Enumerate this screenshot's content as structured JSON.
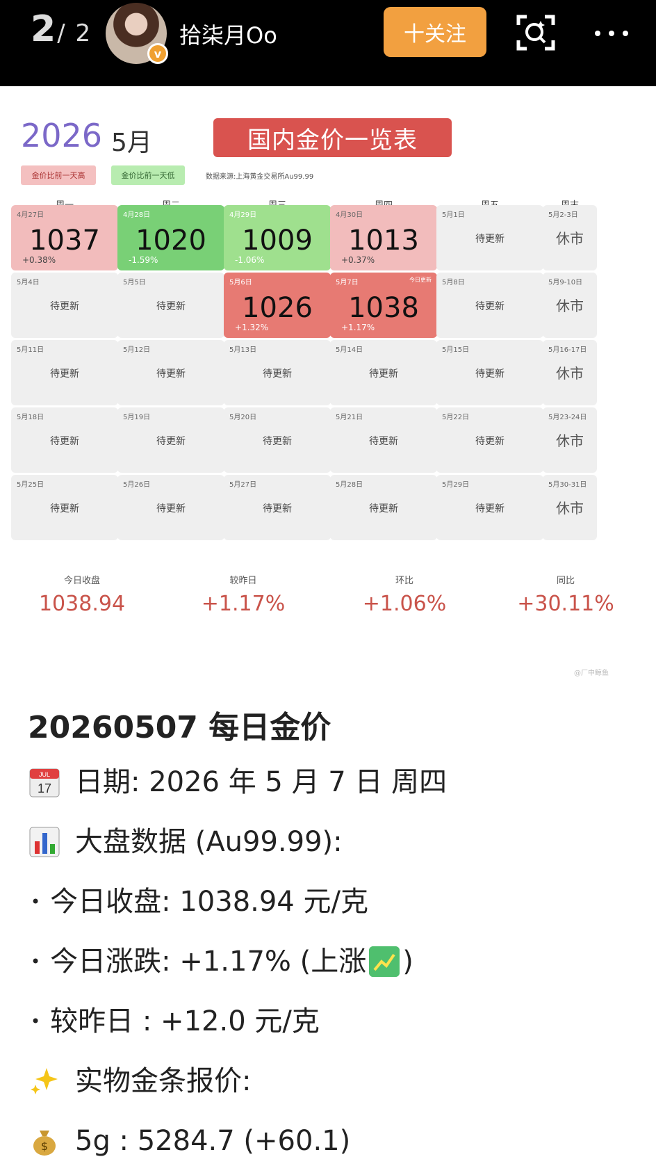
{
  "topbar": {
    "page_current": "2",
    "page_total": "/ 2",
    "username": "拾柒月Oo",
    "verified_badge": "v",
    "follow_label": "十关注",
    "icons": [
      "scan-icon",
      "more-icon"
    ]
  },
  "calendar": {
    "year": "2026",
    "month": "5月",
    "title": "国内金价一览表",
    "legend_high": "金价比前一天高",
    "legend_low": "金价比前一天低",
    "source": "数据来源:上海黄金交易所Au99.99",
    "weekdays": [
      "周一",
      "周二",
      "周三",
      "周四",
      "周五",
      "周末"
    ],
    "pending_label": "待更新",
    "closed_label": "休市",
    "today_tag": "今日更新",
    "rows": [
      [
        {
          "date": "4月27日",
          "price": "1037",
          "change": "+0.38%",
          "state": "up"
        },
        {
          "date": "4月28日",
          "price": "1020",
          "change": "-1.59%",
          "state": "down"
        },
        {
          "date": "4月29日",
          "price": "1009",
          "change": "-1.06%",
          "state": "down2"
        },
        {
          "date": "4月30日",
          "price": "1013",
          "change": "+0.37%",
          "state": "up"
        },
        {
          "date": "5月1日",
          "state": "pending"
        },
        {
          "date": "5月2-3日",
          "state": "closed"
        }
      ],
      [
        {
          "date": "5月4日",
          "state": "pending"
        },
        {
          "date": "5月5日",
          "state": "pending"
        },
        {
          "date": "5月6日",
          "price": "1026",
          "change": "+1.32%",
          "state": "up2"
        },
        {
          "date": "5月7日",
          "price": "1038",
          "change": "+1.17%",
          "state": "up2",
          "today": true
        },
        {
          "date": "5月8日",
          "state": "pending"
        },
        {
          "date": "5月9-10日",
          "state": "closed"
        }
      ],
      [
        {
          "date": "5月11日",
          "state": "pending"
        },
        {
          "date": "5月12日",
          "state": "pending"
        },
        {
          "date": "5月13日",
          "state": "pending"
        },
        {
          "date": "5月14日",
          "state": "pending"
        },
        {
          "date": "5月15日",
          "state": "pending"
        },
        {
          "date": "5月16-17日",
          "state": "closed"
        }
      ],
      [
        {
          "date": "5月18日",
          "state": "pending"
        },
        {
          "date": "5月19日",
          "state": "pending"
        },
        {
          "date": "5月20日",
          "state": "pending"
        },
        {
          "date": "5月21日",
          "state": "pending"
        },
        {
          "date": "5月22日",
          "state": "pending"
        },
        {
          "date": "5月23-24日",
          "state": "closed"
        }
      ],
      [
        {
          "date": "5月25日",
          "state": "pending"
        },
        {
          "date": "5月26日",
          "state": "pending"
        },
        {
          "date": "5月27日",
          "state": "pending"
        },
        {
          "date": "5月28日",
          "state": "pending"
        },
        {
          "date": "5月29日",
          "state": "pending"
        },
        {
          "date": "5月30-31日",
          "state": "closed"
        }
      ]
    ],
    "stats": [
      {
        "label": "今日收盘",
        "value": "1038.94"
      },
      {
        "label": "较昨日",
        "value": "+1.17%"
      },
      {
        "label": "环比",
        "value": "+1.06%"
      },
      {
        "label": "同比",
        "value": "+30.11%"
      }
    ],
    "watermark": "@厂中鲸鱼",
    "colors": {
      "up": "#f2bcbc",
      "up_strong": "#e77a73",
      "down": "#79d076",
      "pending": "#efefef",
      "stat_value": "#c9534a",
      "title_bg": "#d9534f",
      "year": "#7b68c8"
    }
  },
  "article": {
    "heading": "20260507 每日金价",
    "date_line": "日期: 2026 年 5 月 7 日 周四",
    "calendar_emoji_month": "JUL",
    "calendar_emoji_day": "17",
    "market_line": "大盘数据 (Au99.99):",
    "close_line": "今日收盘: 1038.94 元/克",
    "change_prefix": "今日涨跌: +1.17% (上涨",
    "change_suffix": ")",
    "vs_yesterday": "较昨日 : +12.0 元/克",
    "bar_quote": "实物金条报价:",
    "g5_line": "5g : 5284.7 (+60.1)",
    "bullet": "•",
    "icons": [
      "calendar-icon",
      "bar-chart-icon",
      "chart-up-icon",
      "sparkles-icon",
      "money-bag-icon"
    ]
  }
}
